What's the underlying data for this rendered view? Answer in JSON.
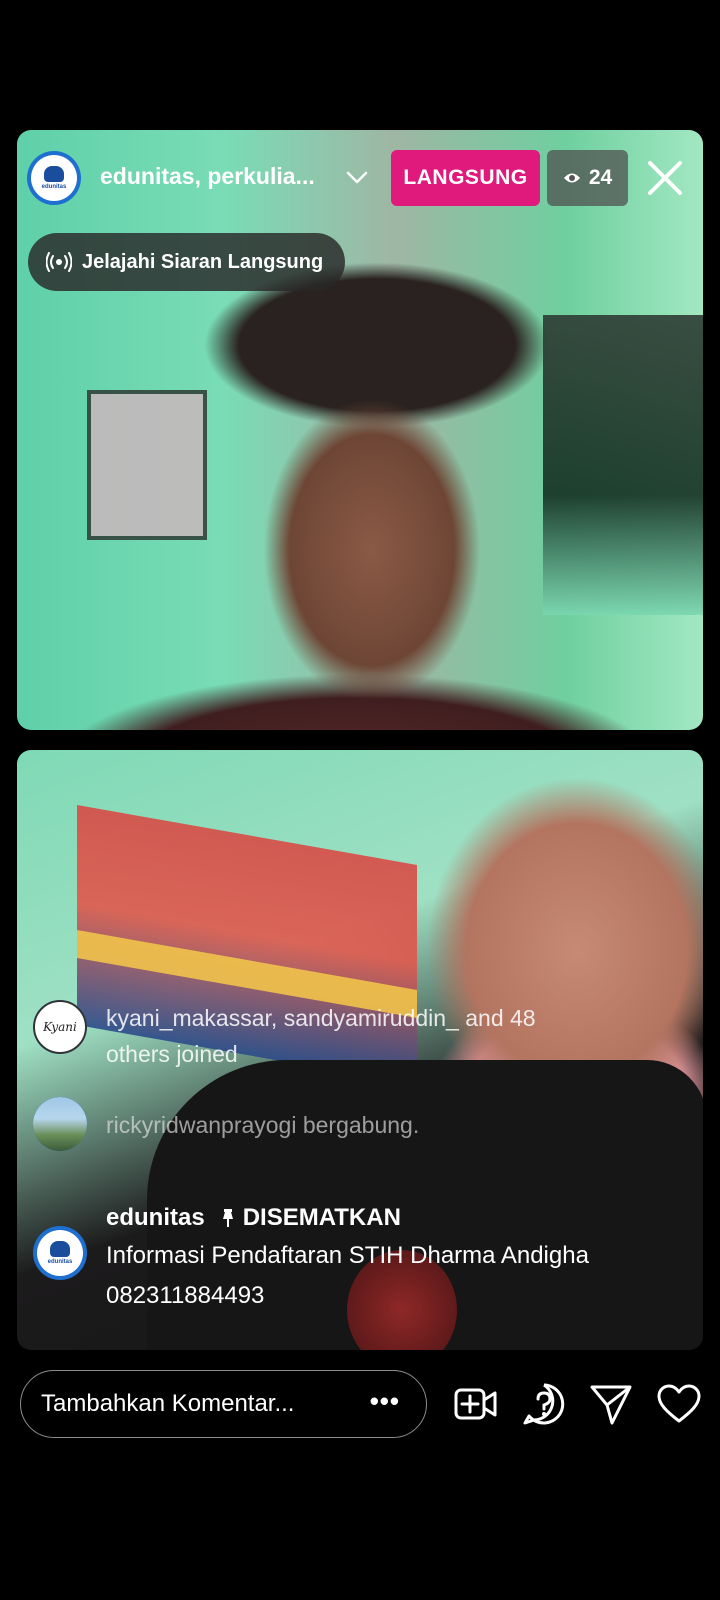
{
  "live": {
    "host_name": "edunitas, perkulia...",
    "badge_label": "LANGSUNG",
    "viewer_count": "24",
    "explore_label": "Jelajahi Siaran Langsung"
  },
  "comments": [
    {
      "user": "kyani_makassar",
      "avatar_text": "Kyani",
      "text": "kyani_makassar, sandyamiruddin_ and 48 others joined"
    },
    {
      "user": "rickyridwanprayogi",
      "text": "rickyridwanprayogi bergabung."
    }
  ],
  "pinned": {
    "user": "edunitas",
    "label": "DISEMATKAN",
    "line1": "Informasi Pendaftaran STIH Dharma Andigha",
    "line2": "082311884493"
  },
  "composer": {
    "placeholder": "Tambahkan Komentar...",
    "more_label": "•••"
  },
  "icons": {
    "host_avatar": "edunitas-logo",
    "chevron": "chevron-down-icon",
    "close": "close-icon",
    "viewers": "eye-icon",
    "broadcast": "broadcast-icon",
    "pin": "pin-icon",
    "actions": [
      "add-video-icon",
      "question-icon",
      "send-icon",
      "heart-icon"
    ]
  }
}
